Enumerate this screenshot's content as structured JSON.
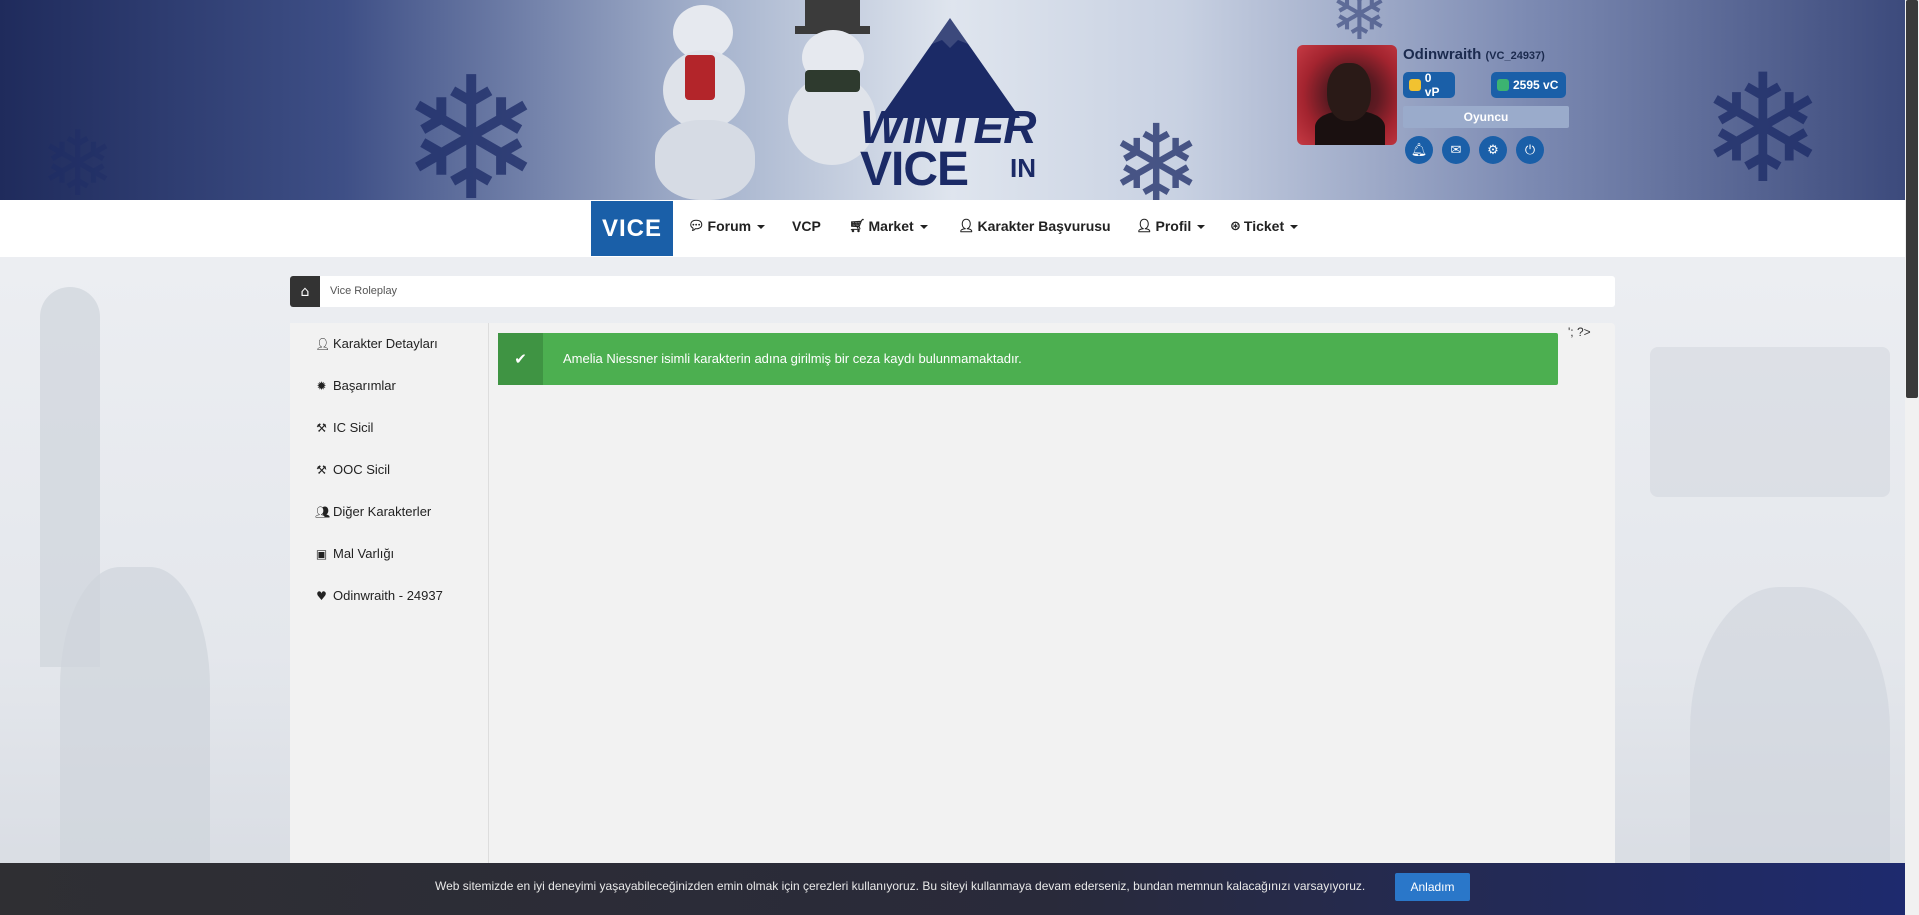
{
  "header": {
    "logo_line1": "WINTER",
    "logo_line2": "VICE",
    "logo_in": "IN"
  },
  "user": {
    "name": "Odinwraith",
    "id": "(VC_24937)",
    "vp": "0 vP",
    "vc": "2595 vC",
    "role": "Oyuncu",
    "actions": [
      "bell-icon",
      "mail-icon",
      "gear-icon",
      "logout-icon"
    ]
  },
  "nav": {
    "brand": "VICE",
    "items": [
      {
        "label": "Forum",
        "icon": "comments-icon",
        "dropdown": true
      },
      {
        "label": "VCP",
        "icon": "",
        "dropdown": false
      },
      {
        "label": "Market",
        "icon": "cart-icon",
        "dropdown": true
      },
      {
        "label": "Karakter Başvurusu",
        "icon": "user-plus-icon",
        "dropdown": false
      },
      {
        "label": "Profil",
        "icon": "user-icon",
        "dropdown": true
      },
      {
        "label": "Ticket",
        "icon": "lifebuoy-icon",
        "dropdown": true
      }
    ]
  },
  "breadcrumb": {
    "home_icon": "home-icon",
    "current": "Vice Roleplay"
  },
  "sidebar": {
    "items": [
      {
        "label": "Karakter Detayları",
        "icon": "user-icon"
      },
      {
        "label": "Başarımlar",
        "icon": "badge-icon"
      },
      {
        "label": "IC Sicil",
        "icon": "gavel-icon"
      },
      {
        "label": "OOC Sicil",
        "icon": "gavel-icon"
      },
      {
        "label": "Diğer Karakterler",
        "icon": "users-icon"
      },
      {
        "label": "Mal Varlığı",
        "icon": "money-icon"
      },
      {
        "label": "Odinwraith - 24937",
        "icon": "heart-icon"
      }
    ]
  },
  "stray_text": "'; ?>",
  "alert": {
    "icon": "check-icon",
    "message": "Amelia Niessner isimli karakterin adına girilmiş bir ceza kaydı bulunmamaktadır."
  },
  "cookie": {
    "message": "Web sitemizde en iyi deneyimi yaşayabileceğinizden emin olmak için çerezleri kullanıyoruz. Bu siteyi kullanmaya devam ederseniz, bundan memnun kalacağınızı varsayıyoruz.",
    "button": "Anladım"
  },
  "colors": {
    "primary": "#1a5fa8",
    "success": "#4caf50",
    "dark_navy": "#1b2a66"
  }
}
